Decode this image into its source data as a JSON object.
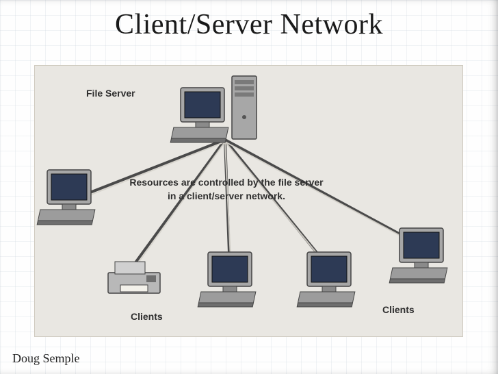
{
  "slide": {
    "title": "Client/Server Network",
    "footer": "Doug Semple"
  },
  "diagram": {
    "server_label": "File Server",
    "caption_line1": "Resources are controlled by the file server",
    "caption_line2": "in a client/server network.",
    "clients_label_left": "Clients",
    "clients_label_right": "Clients",
    "nodes": {
      "server": "file-server",
      "clients": [
        "workstation",
        "printer",
        "workstation",
        "workstation",
        "workstation"
      ]
    }
  },
  "colors": {
    "slide_bg": "#fefefe",
    "diagram_bg": "#e9e7e2",
    "device_gray": "#a7a7a7",
    "device_dark": "#6e6e6e",
    "screen": "#2d3a55",
    "line": "#4a4a4a"
  }
}
